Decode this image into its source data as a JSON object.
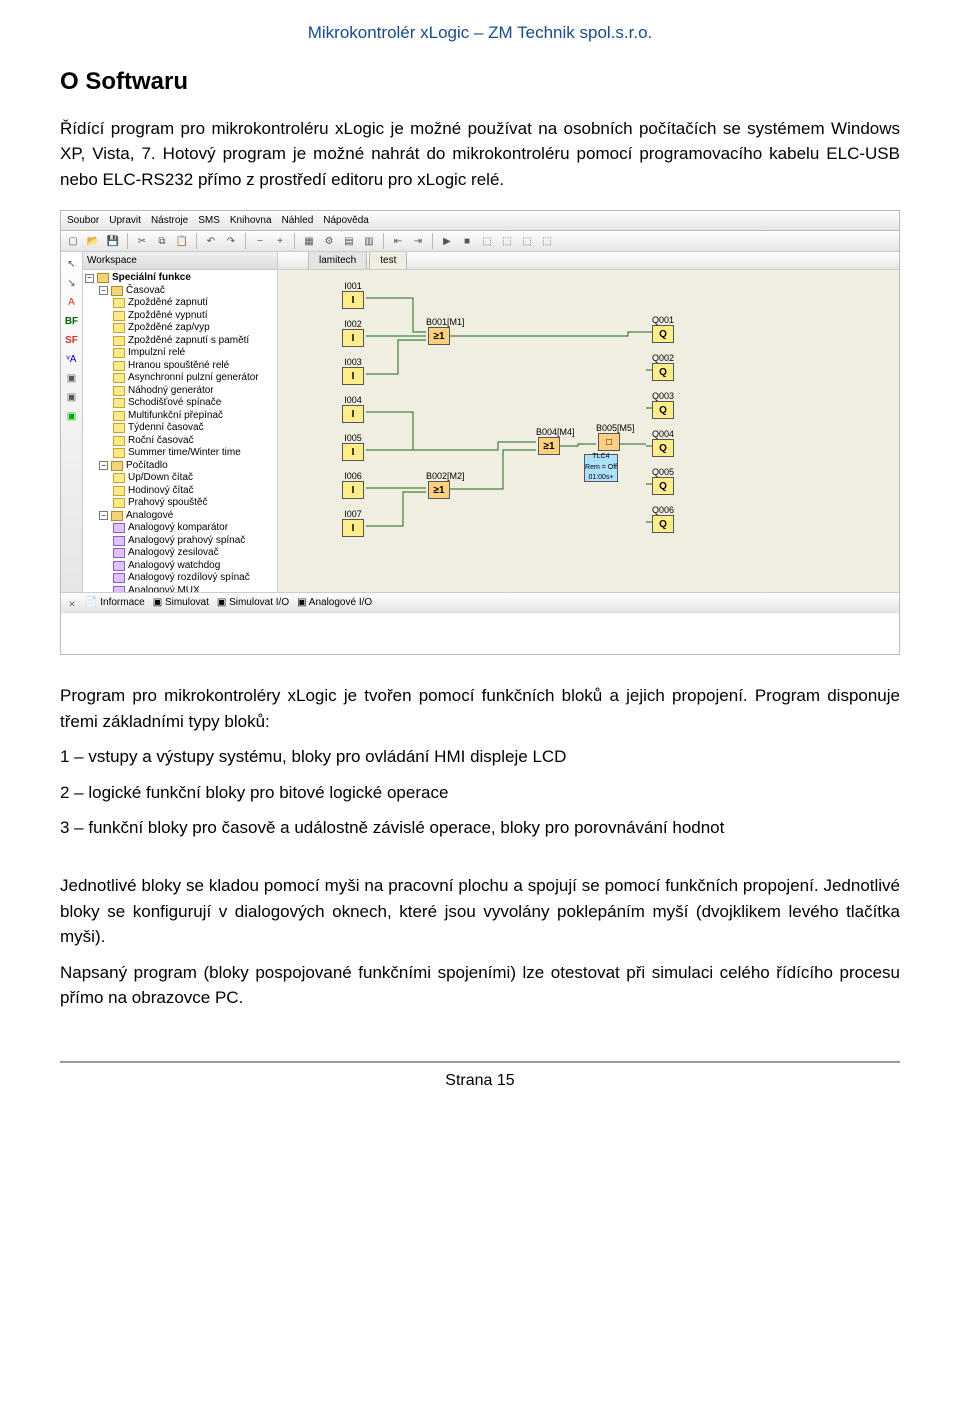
{
  "header": {
    "title": "Mikrokontrolér xLogic – ZM Technik spol.s.r.o."
  },
  "heading": "O Softwaru",
  "para1": "Řídící program pro mikrokontroléru xLogic je možné používat na osobních počítačích se systémem Windows XP, Vista, 7. Hotový program je možné nahrát do mikrokontroléru pomocí programovacího kabelu ELC-USB nebo ELC-RS232 přímo z prostředí editoru pro xLogic relé.",
  "para2": "Program pro mikrokontroléry xLogic je tvořen pomocí funkčních bloků a jejich propojení. Program disponuje třemi základními typy bloků:",
  "bullet1": "1 – vstupy a výstupy systému, bloky pro ovládání HMI displeje LCD",
  "bullet2": "2 – logické funkční bloky pro bitové logické operace",
  "bullet3": "3 – funkční bloky pro časově a událostně závislé operace, bloky pro porovnávání hodnot",
  "para3": "Jednotlivé bloky se kladou pomocí myši na pracovní plochu a spojují se pomocí funkčních propojení. Jednotlivé bloky se konfigurují v dialogových oknech, které jsou vyvolány poklepáním myší (dvojklikem levého tlačítka myši).",
  "para4": "Napsaný program (bloky pospojované funkčními spojeními) lze otestovat při simulaci celého řídícího procesu přímo na obrazovce PC.",
  "footer": {
    "page": "Strana 15"
  },
  "ide": {
    "menu": [
      "Soubor",
      "Upravit",
      "Nástroje",
      "SMS",
      "Knihovna",
      "Náhled",
      "Nápověda"
    ],
    "workspace_label": "Workspace",
    "tabs": [
      "lamitech",
      "test"
    ],
    "tree": {
      "root": "Speciální funkce",
      "groups": [
        {
          "name": "Časovač",
          "items": [
            "Zpožděné zapnutí",
            "Zpožděné vypnutí",
            "Zpožděné zap/vyp",
            "Zpožděné zapnutí s pamětí",
            "Impulzní relé",
            "Hranou spouštěné relé",
            "Asynchronní pulzní generátor",
            "Náhodný generátor",
            "Schodišťové spínače",
            "Multifunkční přepínač",
            "Týdenní časovač",
            "Roční časovač",
            "Summer time/Winter time"
          ]
        },
        {
          "name": "Počítadlo",
          "items": [
            "Up/Down čítač",
            "Hodinový čítač",
            "Prahový spouštěč"
          ]
        },
        {
          "name": "Analogové",
          "items": [
            "Analogový komparátor",
            "Analogový prahový spínač",
            "Analogový zesilovač",
            "Analogový watchdog",
            "Analogový rozdílový spínač",
            "Analogový MUX"
          ]
        }
      ]
    },
    "blocks": {
      "inputs": [
        {
          "label": "I001",
          "sym": "I"
        },
        {
          "label": "I002",
          "sym": "I"
        },
        {
          "label": "I003",
          "sym": "I"
        },
        {
          "label": "I004",
          "sym": "I"
        },
        {
          "label": "I005",
          "sym": "I"
        },
        {
          "label": "I006",
          "sym": "I"
        },
        {
          "label": "I007",
          "sym": "I"
        }
      ],
      "outputs": [
        {
          "label": "Q001",
          "sym": "Q"
        },
        {
          "label": "Q002",
          "sym": "Q"
        },
        {
          "label": "Q003",
          "sym": "Q"
        },
        {
          "label": "Q004",
          "sym": "Q"
        },
        {
          "label": "Q005",
          "sym": "Q"
        },
        {
          "label": "Q006",
          "sym": "Q"
        }
      ],
      "mids": [
        {
          "label": "B001[M1]",
          "sym": "≥1"
        },
        {
          "label": "B002[M2]",
          "sym": "≥1"
        },
        {
          "label": "B004[M4]",
          "sym": "≥1"
        },
        {
          "label": "B005[M5]",
          "sym": "□"
        }
      ],
      "bluelabel": "TLC4\nRem = Off\n01:00s+"
    },
    "bottom_tabs": [
      "Informace",
      "Simulovat",
      "Simulovat I/O",
      "Analogové I/O"
    ]
  }
}
